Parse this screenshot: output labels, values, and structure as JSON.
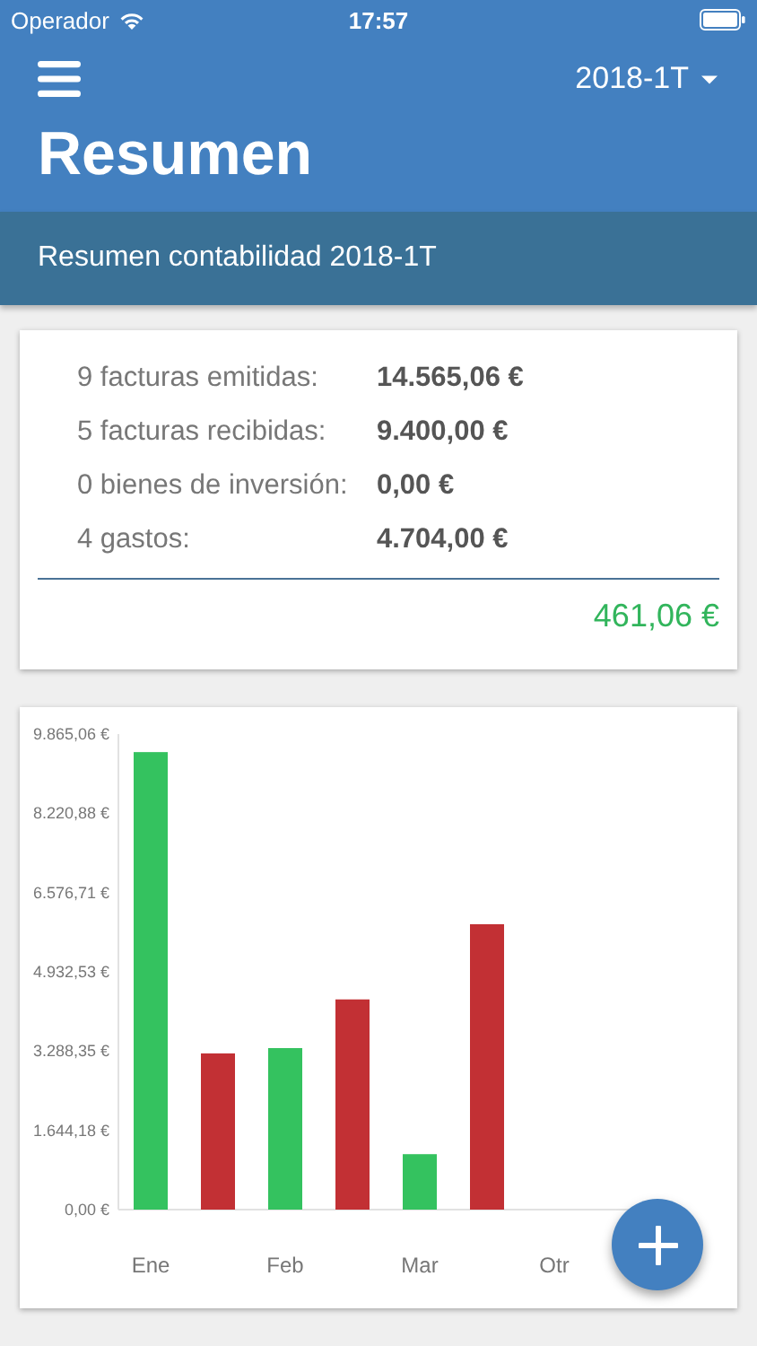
{
  "status_bar": {
    "carrier": "Operador",
    "time": "17:57"
  },
  "nav_bar": {
    "period": "2018-1T",
    "title": "Resumen"
  },
  "subheader": "Resumen contabilidad 2018-1T",
  "summary": {
    "rows": [
      {
        "label": "9 facturas emitidas:",
        "value": "14.565,06 €"
      },
      {
        "label": "5 facturas recibidas:",
        "value": "9.400,00 €"
      },
      {
        "label": "0 bienes de inversión:",
        "value": "0,00 €"
      },
      {
        "label": "4 gastos:",
        "value": "4.704,00 €"
      }
    ],
    "total": "461,06 €"
  },
  "chart_data": {
    "type": "bar",
    "categories": [
      "Ene",
      "Feb",
      "Mar",
      "Otr"
    ],
    "series": [
      {
        "color": "#34c25f",
        "values": [
          9490,
          3350,
          1150,
          null
        ]
      },
      {
        "color": "#c23034",
        "values": [
          3240,
          4360,
          5920,
          null
        ]
      }
    ],
    "ylim": [
      0,
      9865.06
    ],
    "yticks": [
      {
        "value": 0,
        "label": "0,00 €"
      },
      {
        "value": 1644.18,
        "label": "1.644,18 €"
      },
      {
        "value": 3288.35,
        "label": "3.288,35 €"
      },
      {
        "value": 4932.53,
        "label": "4.932,53 €"
      },
      {
        "value": 6576.71,
        "label": "6.576,71 €"
      },
      {
        "value": 8220.88,
        "label": "8.220,88 €"
      },
      {
        "value": 9865.06,
        "label": "9.865,06 €"
      }
    ]
  }
}
